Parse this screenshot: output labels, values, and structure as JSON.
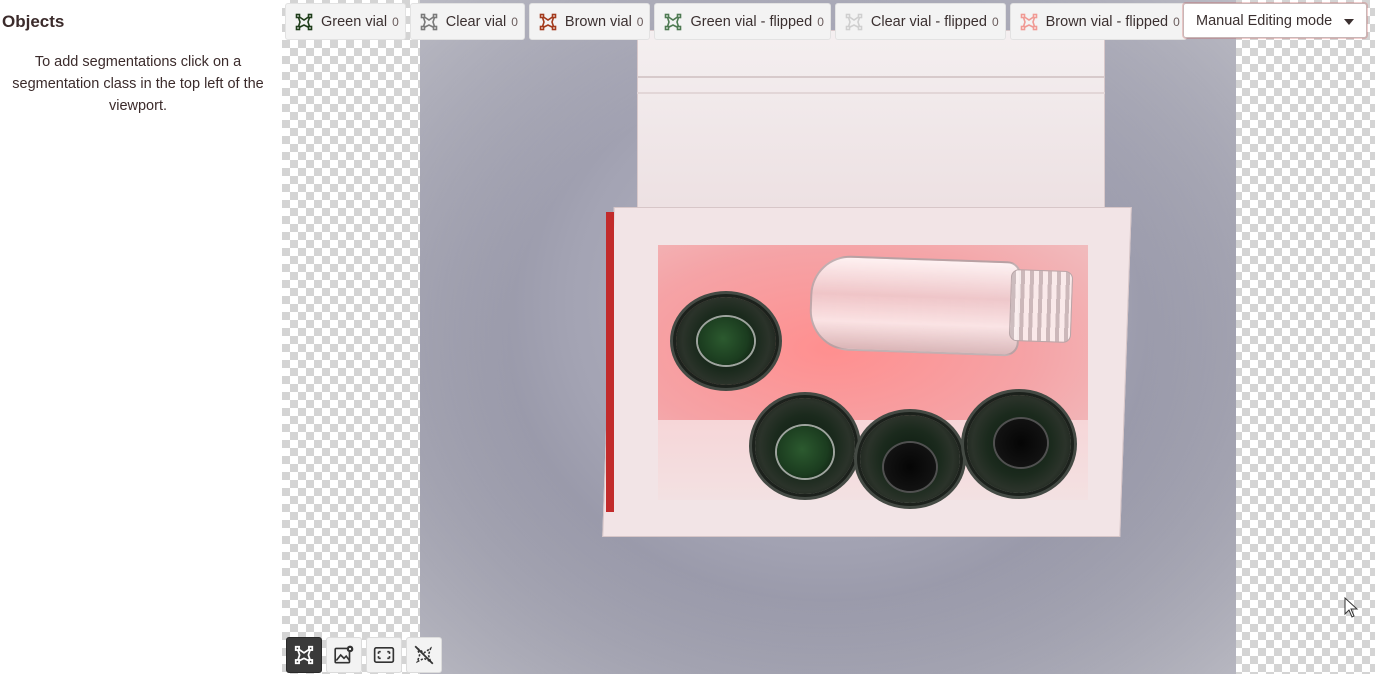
{
  "sidebar": {
    "title": "Objects",
    "hint": "To add segmentations click on a segmentation class in the top left of the viewport."
  },
  "classes": [
    {
      "label": "Green vial",
      "count": "0",
      "color": "#1f3d1a",
      "icon": "segmentation-polygon-icon"
    },
    {
      "label": "Clear vial",
      "count": "0",
      "color": "#7a7a7a",
      "icon": "segmentation-polygon-icon"
    },
    {
      "label": "Brown vial",
      "count": "0",
      "color": "#a33a1c",
      "icon": "segmentation-polygon-icon"
    },
    {
      "label": "Green vial - flipped",
      "count": "0",
      "color": "#4e7a52",
      "icon": "segmentation-polygon-icon"
    },
    {
      "label": "Clear vial - flipped",
      "count": "0",
      "color": "#cfcfcf",
      "icon": "segmentation-polygon-icon"
    },
    {
      "label": "Brown vial - flipped",
      "count": "0",
      "color": "#f09a94",
      "icon": "segmentation-polygon-icon"
    }
  ],
  "mode": {
    "selected": "Manual Editing mode"
  },
  "tools": [
    {
      "name": "segmentation-tool",
      "icon": "segmentation-polygon-icon",
      "active": true
    },
    {
      "name": "image-settings-tool",
      "icon": "image-settings-icon",
      "active": false
    },
    {
      "name": "fit-view-tool",
      "icon": "fit-view-icon",
      "active": false
    },
    {
      "name": "hide-segmentations-tool",
      "icon": "hide-segmentations-icon",
      "active": false
    }
  ]
}
